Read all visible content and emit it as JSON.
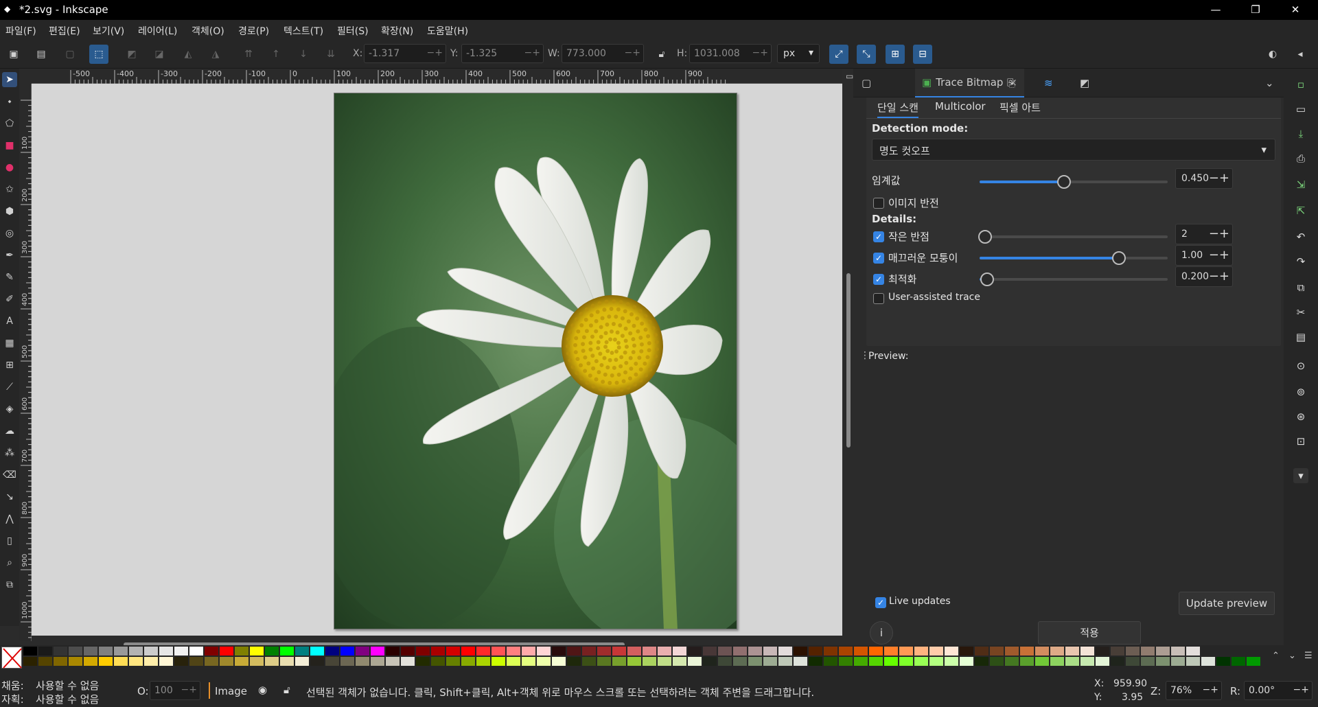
{
  "window": {
    "title": "*2.svg - Inkscape",
    "minimize_icon": "minimize-icon",
    "maximize_icon": "restore-icon",
    "close_icon": "close-icon"
  },
  "menu": [
    "파일(F)",
    "편집(E)",
    "보기(V)",
    "레이어(L)",
    "객체(O)",
    "경로(P)",
    "텍스트(T)",
    "필터(S)",
    "확장(N)",
    "도움말(H)"
  ],
  "toolbar": {
    "x_label": "X:",
    "x_value": "-1.317",
    "y_label": "Y:",
    "y_value": "-1.325",
    "w_label": "W:",
    "w_value": "773.000",
    "h_label": "H:",
    "h_value": "1031.008",
    "unit": "px",
    "spin_pm": "−+"
  },
  "rulers": {
    "h_ticks": [
      "-500",
      "-400",
      "-300",
      "-200",
      "-100",
      "0",
      "100",
      "200",
      "300",
      "400",
      "500",
      "600",
      "700",
      "800",
      "900"
    ],
    "v_ticks": [
      "100",
      "200",
      "300",
      "400",
      "500",
      "600",
      "700",
      "800",
      "900",
      "1000"
    ]
  },
  "dock": {
    "tab_label": "Trace Bitmap",
    "tab_close": "×",
    "subtabs": [
      "단일 스캔",
      "Multicolor",
      "픽셀 아트"
    ],
    "detection_label": "Detection mode:",
    "detection_value": "명도 컷오프",
    "threshold_label": "임계값",
    "threshold_value": "0.450",
    "threshold_level": 0.45,
    "invert_label": "이미지 반전",
    "invert_checked": false,
    "details_label": "Details:",
    "speckles_label": "작은 반점",
    "speckles_value": "2",
    "speckles_level": 0.0,
    "smooth_label": "매끄러운 모퉁이",
    "smooth_value": "1.00",
    "smooth_level": 0.74,
    "optimize_label": "최적화",
    "optimize_value": "0.200",
    "optimize_level": 0.04,
    "user_assisted_label": "User-assisted trace",
    "preview_label": "Preview:",
    "live_updates_label": "Live updates",
    "update_preview_label": "Update preview",
    "apply_label": "적용",
    "info_icon": "i"
  },
  "status": {
    "fill_label": "채움:",
    "fill_value": "사용할 수 없음",
    "stroke_label": "자획:",
    "stroke_value": "사용할 수 없음",
    "opacity_label": "O:",
    "opacity_value": "100",
    "layer": "Image",
    "message": "선택된 객체가 없습니다. 클릭, Shift+클릭, Alt+객체 위로 마우스 스크롤 또는 선택하려는 객체 주변을 드래그합니다.",
    "x_label": "X:",
    "x_value": "959.90",
    "y_label": "Y:",
    "y_value": "3.95",
    "zoom_label": "Z:",
    "zoom_value": "76%",
    "rot_label": "R:",
    "rot_value": "0.00°"
  },
  "palette_colors": [
    "#000000",
    "#1a1a1a",
    "#333333",
    "#4d4d4d",
    "#666666",
    "#808080",
    "#999999",
    "#b3b3b3",
    "#cccccc",
    "#e6e6e6",
    "#f2f2f2",
    "#ffffff",
    "#800000",
    "#ff0000",
    "#808000",
    "#ffff00",
    "#008000",
    "#00ff00",
    "#008080",
    "#00ffff",
    "#000080",
    "#0000ff",
    "#800080",
    "#ff00ff",
    "#2b0000",
    "#550000",
    "#800000",
    "#aa0000",
    "#d40000",
    "#ff0000",
    "#ff2a2a",
    "#ff5555",
    "#ff8080",
    "#ffaaaa",
    "#ffd5d5",
    "#280b0b",
    "#501616",
    "#782121",
    "#a02c2c",
    "#c83737",
    "#d35f5f",
    "#de8787",
    "#e9afaf",
    "#f4d7d7",
    "#241c1c",
    "#483737",
    "#6c5353",
    "#916f6f",
    "#ac9393",
    "#c8b7b7",
    "#e3dbdb",
    "#2b1100",
    "#552200",
    "#803300",
    "#aa4400",
    "#d45500",
    "#ff6600",
    "#ff7f2a",
    "#ff9955",
    "#ffb380",
    "#ffccaa",
    "#ffe6d5",
    "#28170b",
    "#502d16",
    "#784421",
    "#a05a2c",
    "#c87137",
    "#d38d5f",
    "#deaa87",
    "#e9c6af",
    "#f4e3d7",
    "#241f1c",
    "#483e37",
    "#6c5d53",
    "#917c6f",
    "#ac9d93",
    "#c8beb7",
    "#e3dedb"
  ],
  "palette_colors2": [
    "#2b2200",
    "#554400",
    "#806600",
    "#aa8800",
    "#d4aa00",
    "#ffcc00",
    "#ffdd55",
    "#ffe680",
    "#ffeeaa",
    "#fff6d5",
    "#28220b",
    "#504416",
    "#786721",
    "#a0892c",
    "#c8ab37",
    "#d3bc5f",
    "#decd87",
    "#e9ddaf",
    "#f4eed7",
    "#24221c",
    "#484537",
    "#6c6753",
    "#918a6f",
    "#aca793",
    "#c8c4b7",
    "#e3e2db",
    "#222b00",
    "#445500",
    "#668000",
    "#88aa00",
    "#aad400",
    "#ccff00",
    "#ddff55",
    "#e5ff80",
    "#eeffaa",
    "#f6ffd5",
    "#1e280b",
    "#3c5016",
    "#5a7821",
    "#78a02c",
    "#96c837",
    "#abd35f",
    "#c0de87",
    "#d5e9af",
    "#eaf4d7",
    "#1f241c",
    "#3e4837",
    "#5d6c53",
    "#7c916f",
    "#9dac93",
    "#bec8b7",
    "#dee3db",
    "#112b00",
    "#225500",
    "#338000",
    "#44aa00",
    "#55d400",
    "#66ff00",
    "#7fff2a",
    "#99ff55",
    "#b3ff80",
    "#ccffaa",
    "#e5ffd5",
    "#172808",
    "#2d5016",
    "#447821",
    "#5aa02c",
    "#71c837",
    "#8dd35f",
    "#aade87",
    "#c6e9af",
    "#e3f4d7",
    "#1f241c",
    "#3e4837",
    "#5d6c53",
    "#7c916f",
    "#9dac93",
    "#bec8b7",
    "#dee3db",
    "#003300",
    "#006600",
    "#009900"
  ]
}
